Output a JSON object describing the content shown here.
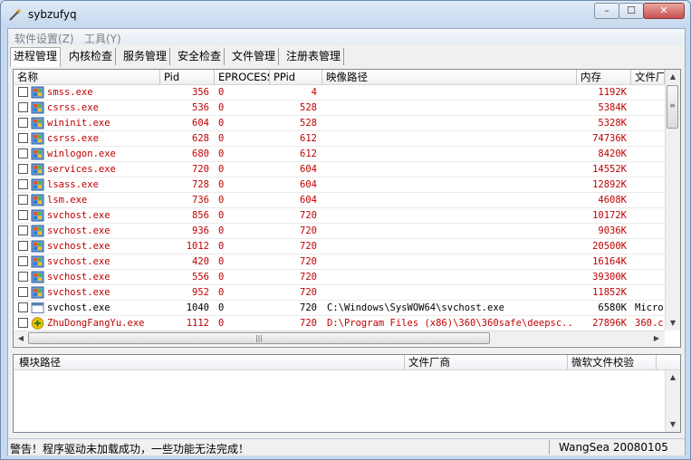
{
  "window": {
    "title": "sybzufyq"
  },
  "controls": {
    "minimize": "–",
    "maximize": "☐",
    "close": "✕"
  },
  "menus": [
    "软件设置(Z)",
    "工具(Y)"
  ],
  "tabs": [
    "进程管理",
    "内核检查",
    "服务管理",
    "安全检查",
    "文件管理",
    "注册表管理"
  ],
  "process_table": {
    "columns": [
      "名称",
      "Pid",
      "EPROCESS",
      "PPid",
      "映像路径",
      "内存",
      "文件厂"
    ],
    "rows": [
      {
        "name": "smss.exe",
        "pid": "356",
        "eprocess": "0",
        "ppid": "4",
        "path": "",
        "mem": "1192K",
        "vendor": "",
        "color": "red",
        "icon": "windows-process-icon"
      },
      {
        "name": "csrss.exe",
        "pid": "536",
        "eprocess": "0",
        "ppid": "528",
        "path": "",
        "mem": "5384K",
        "vendor": "",
        "color": "red",
        "icon": "windows-process-icon"
      },
      {
        "name": "wininit.exe",
        "pid": "604",
        "eprocess": "0",
        "ppid": "528",
        "path": "",
        "mem": "5328K",
        "vendor": "",
        "color": "red",
        "icon": "windows-process-icon"
      },
      {
        "name": "csrss.exe",
        "pid": "628",
        "eprocess": "0",
        "ppid": "612",
        "path": "",
        "mem": "74736K",
        "vendor": "",
        "color": "red",
        "icon": "windows-process-icon"
      },
      {
        "name": "winlogon.exe",
        "pid": "680",
        "eprocess": "0",
        "ppid": "612",
        "path": "",
        "mem": "8420K",
        "vendor": "",
        "color": "red",
        "icon": "windows-process-icon"
      },
      {
        "name": "services.exe",
        "pid": "720",
        "eprocess": "0",
        "ppid": "604",
        "path": "",
        "mem": "14552K",
        "vendor": "",
        "color": "red",
        "icon": "windows-process-icon"
      },
      {
        "name": "lsass.exe",
        "pid": "728",
        "eprocess": "0",
        "ppid": "604",
        "path": "",
        "mem": "12892K",
        "vendor": "",
        "color": "red",
        "icon": "windows-process-icon"
      },
      {
        "name": "lsm.exe",
        "pid": "736",
        "eprocess": "0",
        "ppid": "604",
        "path": "",
        "mem": "4608K",
        "vendor": "",
        "color": "red",
        "icon": "windows-process-icon"
      },
      {
        "name": "svchost.exe",
        "pid": "856",
        "eprocess": "0",
        "ppid": "720",
        "path": "",
        "mem": "10172K",
        "vendor": "",
        "color": "red",
        "icon": "windows-process-icon"
      },
      {
        "name": "svchost.exe",
        "pid": "936",
        "eprocess": "0",
        "ppid": "720",
        "path": "",
        "mem": "9036K",
        "vendor": "",
        "color": "red",
        "icon": "windows-process-icon"
      },
      {
        "name": "svchost.exe",
        "pid": "1012",
        "eprocess": "0",
        "ppid": "720",
        "path": "",
        "mem": "20500K",
        "vendor": "",
        "color": "red",
        "icon": "windows-process-icon"
      },
      {
        "name": "svchost.exe",
        "pid": "420",
        "eprocess": "0",
        "ppid": "720",
        "path": "",
        "mem": "16164K",
        "vendor": "",
        "color": "red",
        "icon": "windows-process-icon"
      },
      {
        "name": "svchost.exe",
        "pid": "556",
        "eprocess": "0",
        "ppid": "720",
        "path": "",
        "mem": "39300K",
        "vendor": "",
        "color": "red",
        "icon": "windows-process-icon"
      },
      {
        "name": "svchost.exe",
        "pid": "952",
        "eprocess": "0",
        "ppid": "720",
        "path": "",
        "mem": "11852K",
        "vendor": "",
        "color": "red",
        "icon": "windows-process-icon"
      },
      {
        "name": "svchost.exe",
        "pid": "1040",
        "eprocess": "0",
        "ppid": "720",
        "path": "C:\\Windows\\SysWOW64\\svchost.exe",
        "mem": "6580K",
        "vendor": "Micro",
        "color": "black",
        "icon": "application-window-icon"
      },
      {
        "name": "ZhuDongFangYu.exe",
        "pid": "1112",
        "eprocess": "0",
        "ppid": "720",
        "path": "D:\\Program Files (x86)\\360\\360safe\\deepsc...",
        "mem": "27896K",
        "vendor": "360.c",
        "color": "red",
        "icon": "shield-plus-icon"
      }
    ]
  },
  "module_table": {
    "columns": [
      "模块路径",
      "文件厂商",
      "微软文件校验"
    ]
  },
  "status": {
    "message": "警告！程序驱动未加载成功，一些功能无法完成！",
    "version": "WangSea 20080105"
  },
  "colors": {
    "red": "#c00000",
    "black": "#000000",
    "accent": "#c6d9ef"
  }
}
